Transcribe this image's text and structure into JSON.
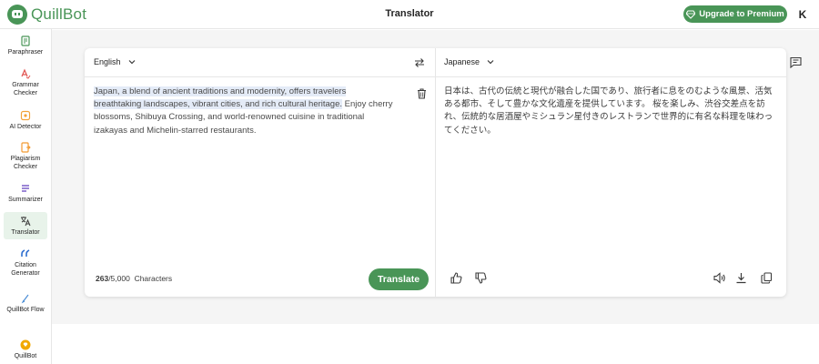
{
  "app": {
    "logo_text": "QuillBot",
    "page_title": "Translator",
    "premium_label": "Upgrade to Premium",
    "avatar_initial": "K"
  },
  "sidebar": {
    "items": [
      {
        "label": "Paraphraser",
        "icon": "paraphraser-icon"
      },
      {
        "label": "Grammar Checker",
        "icon": "grammar-checker-icon"
      },
      {
        "label": "AI Detector",
        "icon": "ai-detector-icon"
      },
      {
        "label": "Plagiarism Checker",
        "icon": "plagiarism-checker-icon"
      },
      {
        "label": "Summarizer",
        "icon": "summarizer-icon"
      },
      {
        "label": "Translator",
        "icon": "translator-icon",
        "active": true
      },
      {
        "label": "Citation Generator",
        "icon": "citation-generator-icon"
      },
      {
        "label": "QuillBot Flow",
        "icon": "quillbot-flow-icon"
      },
      {
        "label": "QuillBot",
        "icon": "quillbot-premium-icon"
      }
    ]
  },
  "translator": {
    "source_lang": "English",
    "target_lang": "Japanese",
    "source_text_highlighted": "Japan, a blend of ancient traditions and modernity, offers travelers breathtaking landscapes, vibrant cities, and rich cultural heritage.",
    "source_text_rest": " Enjoy cherry blossoms, Shibuya Crossing, and world-renowned cuisine in traditional izakayas and Michelin-starred restaurants.",
    "target_text": "日本は、古代の伝統と現代が融合した国であり、旅行者に息をのむような風景、活気ある都市、そして豊かな文化遺産を提供しています。 桜を楽しみ、渋谷交差点を訪れ、伝統的な居酒屋やミシュラン星付きのレストランで世界的に有名な料理を味わってください。",
    "char_count": "263",
    "char_limit": "/5,000",
    "char_label": "Characters",
    "translate_label": "Translate"
  },
  "colors": {
    "brand_green": "#499557",
    "highlight": "#e4ebf7"
  }
}
